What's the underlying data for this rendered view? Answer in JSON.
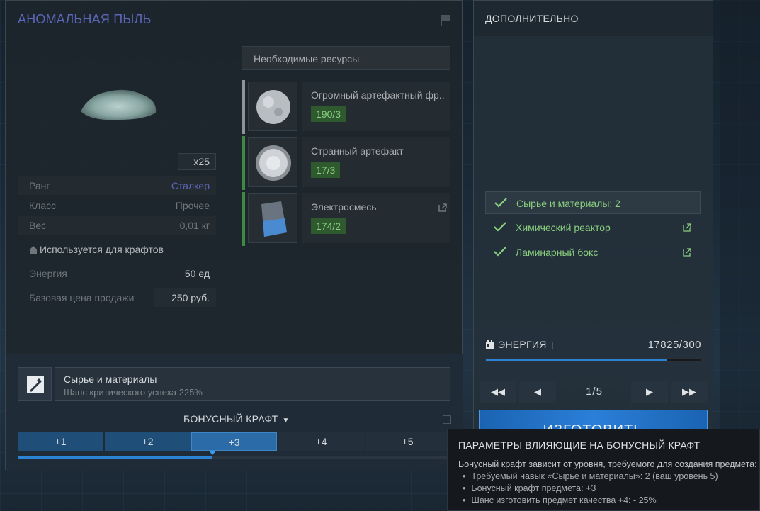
{
  "item": {
    "title": "АНОМАЛЬНАЯ ПЫЛЬ",
    "quantity": "x25",
    "stats": [
      {
        "label": "Ранг",
        "value": "Сталкер"
      },
      {
        "label": "Класс",
        "value": "Прочее"
      },
      {
        "label": "Вес",
        "value": "0,01 кг"
      }
    ],
    "used_for_crafts": "Используется для крафтов",
    "energy_label": "Энергия",
    "energy_value": "50 ед",
    "base_price_label": "Базовая цена продажи",
    "base_price_value": "250 руб."
  },
  "resources": {
    "header": "Необходимые ресурсы",
    "items": [
      {
        "name": "Огромный артефактный фр..",
        "count": "190/3",
        "bar_color": "#8f9499"
      },
      {
        "name": "Странный артефакт",
        "count": "17/3",
        "bar_color": "#3f8a43"
      },
      {
        "name": "Электросмесь",
        "count": "174/2",
        "bar_color": "#3f8a43"
      }
    ]
  },
  "craft": {
    "title": "Сырье и материалы",
    "subtitle": "Шанс критического успеха 225%",
    "bonus_title": "БОНУСНЫЙ КРАФТ",
    "bonus_levels": [
      "+1",
      "+2",
      "+3",
      "+4",
      "+5"
    ],
    "bonus_selected_index": 2,
    "bonus_progress": 0.45
  },
  "extra": {
    "header": "ДОПОЛНИТЕЛЬНО",
    "requirements": [
      {
        "label": "Сырье и материалы: 2",
        "link": false
      },
      {
        "label": "Химический реактор",
        "link": true
      },
      {
        "label": "Ламинарный бокс",
        "link": true
      }
    ],
    "energy_label": "ЭНЕРГИЯ",
    "energy_value": "17825/300",
    "energy_progress": 0.84,
    "page_label": "1/5",
    "make_button": "ИЗГОТОВИТЬ"
  },
  "tooltip": {
    "title": "ПАРАМЕТРЫ ВЛИЯЮЩИЕ НА БОНУСНЫЙ КРАФТ",
    "description": "Бонусный крафт зависит от уровня, требуемого для создания предмета:",
    "items": [
      "Требуемый навык «Сырье и материалы»: 2 (ваш уровень 5)",
      "Бонусный крафт предмета: +3",
      "Шанс изготовить предмет качества +4: - 25%"
    ]
  },
  "colors": {
    "rank": "#5b66b8",
    "accent_blue": "#2a83d4",
    "success_green": "#8ad07e"
  }
}
